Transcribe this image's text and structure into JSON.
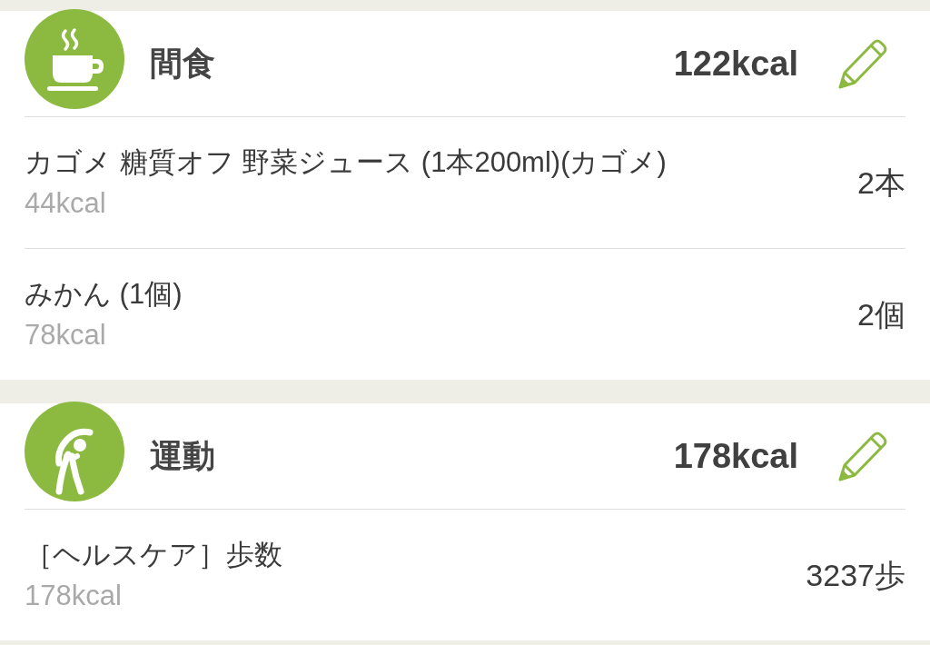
{
  "sections": [
    {
      "kind": "snack",
      "title": "間食",
      "total": "122kcal",
      "items": [
        {
          "name": "カゴメ 糖質オフ 野菜ジュース (1本200ml)(カゴメ)",
          "calories": "44kcal",
          "quantity": "2本"
        },
        {
          "name": "みかん (1個)",
          "calories": "78kcal",
          "quantity": "2個"
        }
      ]
    },
    {
      "kind": "exercise",
      "title": "運動",
      "total": "178kcal",
      "items": [
        {
          "name": "［ヘルスケア］歩数",
          "calories": "178kcal",
          "quantity": "3237歩"
        }
      ]
    }
  ]
}
